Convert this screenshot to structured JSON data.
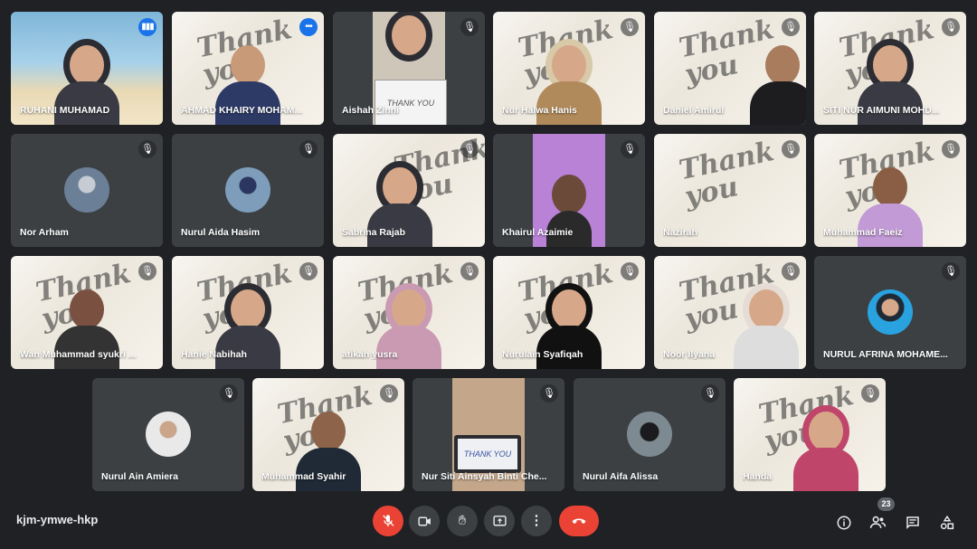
{
  "participants": [
    {
      "name": "RUHANI MUHAMAD",
      "state": "speaking"
    },
    {
      "name": "AHMAD KHAIRY MOHAM...",
      "state": "speaking"
    },
    {
      "name": "Aishah Zinni",
      "state": "muted"
    },
    {
      "name": "Nur Halwa Hanis",
      "state": "muted"
    },
    {
      "name": "Daniel Amirul",
      "state": "muted"
    },
    {
      "name": "SITI NUR AIMUNI MOHD...",
      "state": "muted"
    },
    {
      "name": "Nor Arham",
      "state": "muted"
    },
    {
      "name": "Nurul Aida Hasim",
      "state": "muted"
    },
    {
      "name": "Sabrina Rajab",
      "state": "muted"
    },
    {
      "name": "Khairul Azaimie",
      "state": "muted"
    },
    {
      "name": "Nazirah",
      "state": "muted"
    },
    {
      "name": "Muhammad Faeiz",
      "state": "muted"
    },
    {
      "name": "Wan Muhammad syukri ...",
      "state": "muted"
    },
    {
      "name": "Hanie Nabihah",
      "state": "muted"
    },
    {
      "name": "atikah yusra",
      "state": "muted"
    },
    {
      "name": "Nurulain Syafiqah",
      "state": "muted"
    },
    {
      "name": "Noor Ilyana",
      "state": "muted"
    },
    {
      "name": "NURUL AFRINA MOHAME...",
      "state": "muted"
    },
    {
      "name": "Nurul Ain Amiera",
      "state": "muted"
    },
    {
      "name": "Muhammad Syahir",
      "state": "muted"
    },
    {
      "name": "Nur Siti Ainsyah Binti Che...",
      "state": "muted"
    },
    {
      "name": "Nurul Aifa Alissa",
      "state": "muted"
    },
    {
      "name": "Handa",
      "state": "muted"
    }
  ],
  "video_text": {
    "thank_you": "Thank you",
    "thank_you_sign": "THANK YOU"
  },
  "toolbar": {
    "meeting_code": "kjm-ymwe-hkp",
    "participant_count": "23",
    "mic_icon": "mic-off-icon",
    "camera_icon": "camera-icon",
    "hand_icon": "raise-hand-icon",
    "present_icon": "present-screen-icon",
    "more_icon": "more-options-icon",
    "end_icon": "end-call-icon",
    "info_icon": "info-icon",
    "people_icon": "people-icon",
    "chat_icon": "chat-icon",
    "activities_icon": "activities-icon"
  },
  "colors": {
    "background": "#202124",
    "tile": "#3c4043",
    "accent": "#1a73e8",
    "end_call": "#ea4335",
    "active_border": "#8ab4f8"
  }
}
